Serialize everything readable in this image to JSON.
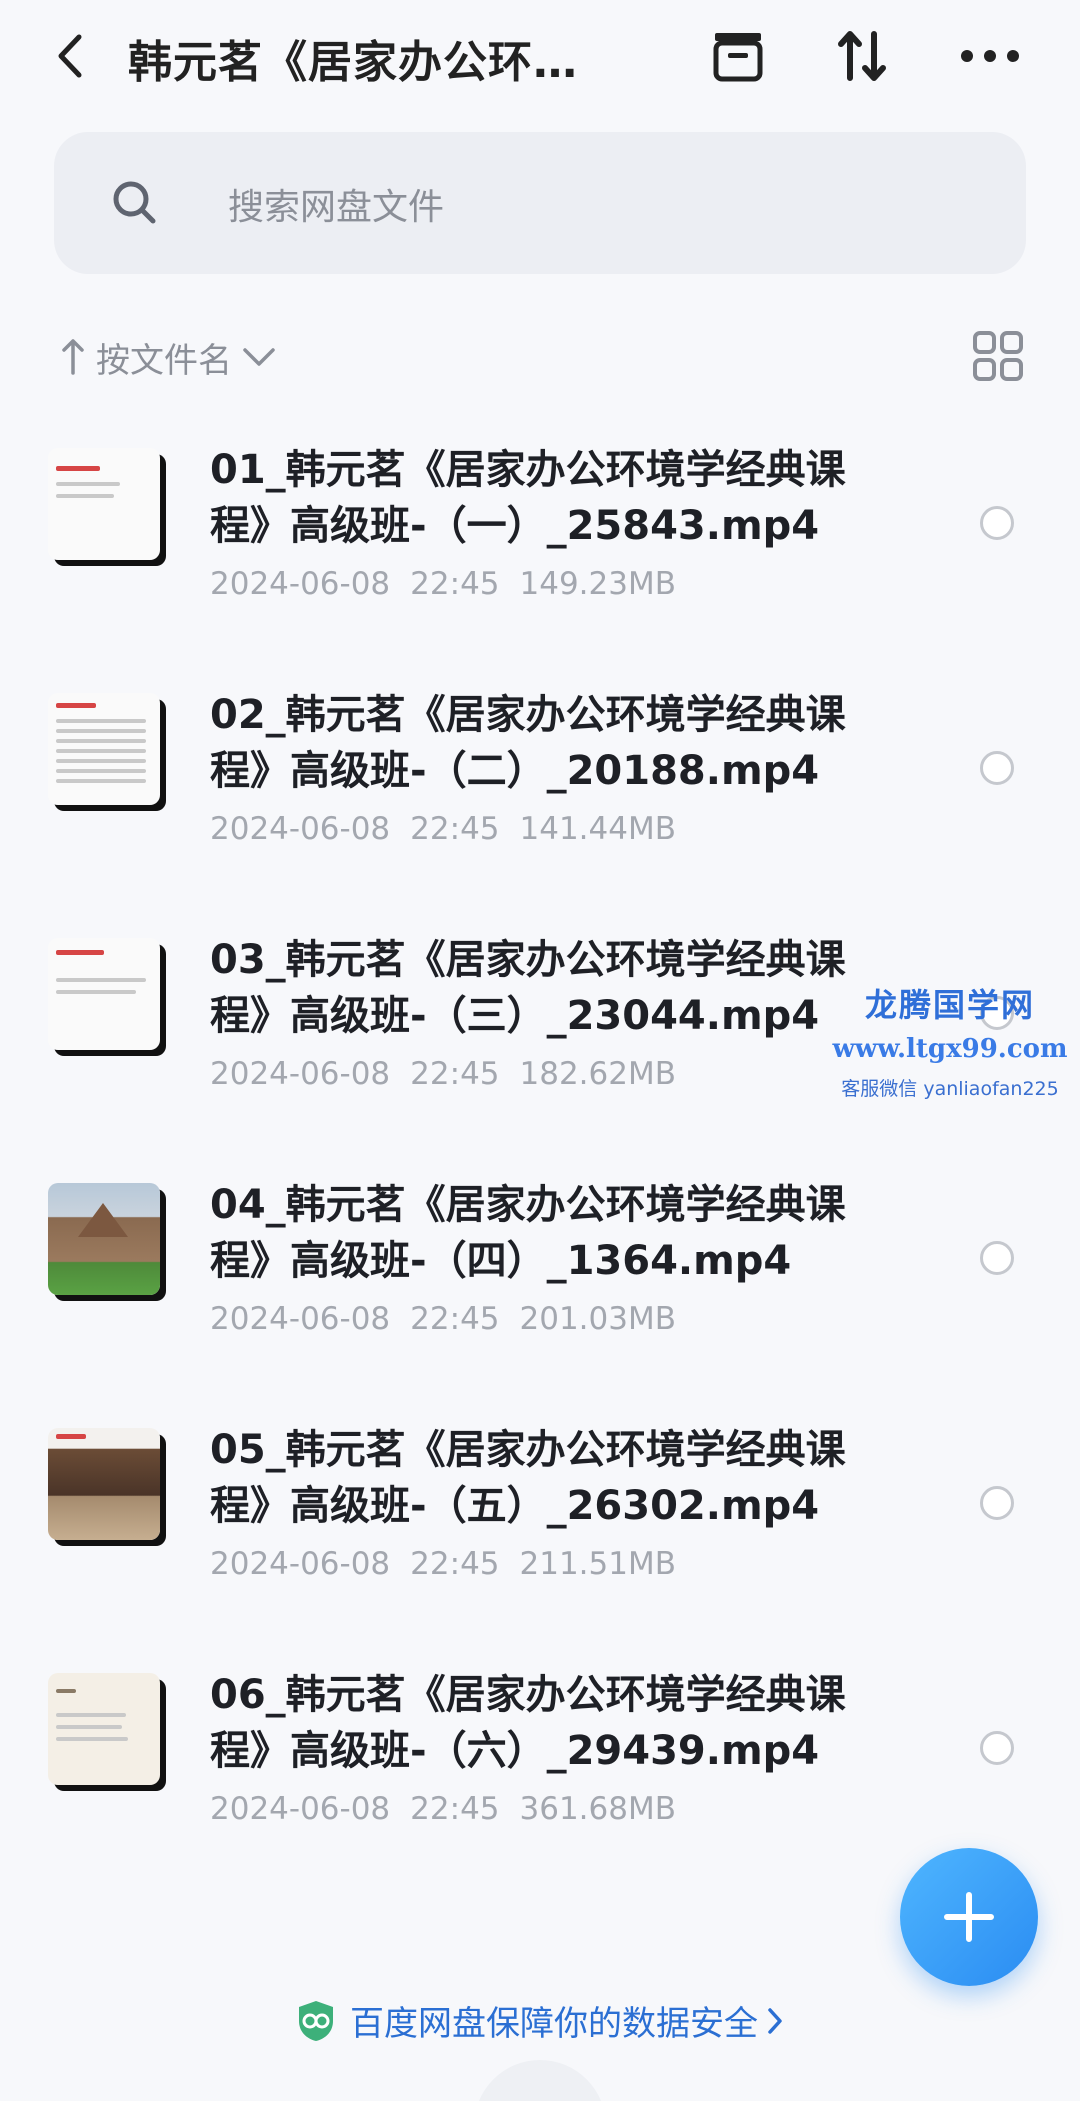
{
  "header": {
    "title": "韩元茗《居家办公环…",
    "icons": [
      "back-icon",
      "archive-icon",
      "sort-icon",
      "more-icon"
    ]
  },
  "search": {
    "placeholder": "搜索网盘文件"
  },
  "sort": {
    "label": "按文件名"
  },
  "files": [
    {
      "name": "01_韩元茗《居家办公环境学经典课程》高级班-（一）_25843.mp4",
      "date": "2024-06-08",
      "time": "22:45",
      "size": "149.23MB"
    },
    {
      "name": "02_韩元茗《居家办公环境学经典课程》高级班-（二）_20188.mp4",
      "date": "2024-06-08",
      "time": "22:45",
      "size": "141.44MB"
    },
    {
      "name": "03_韩元茗《居家办公环境学经典课程》高级班-（三）_23044.mp4",
      "date": "2024-06-08",
      "time": "22:45",
      "size": "182.62MB"
    },
    {
      "name": "04_韩元茗《居家办公环境学经典课程》高级班-（四）_1364.mp4",
      "date": "2024-06-08",
      "time": "22:45",
      "size": "201.03MB"
    },
    {
      "name": "05_韩元茗《居家办公环境学经典课程》高级班-（五）_26302.mp4",
      "date": "2024-06-08",
      "time": "22:45",
      "size": "211.51MB"
    },
    {
      "name": "06_韩元茗《居家办公环境学经典课程》高级班-（六）_29439.mp4",
      "date": "2024-06-08",
      "time": "22:45",
      "size": "361.68MB"
    }
  ],
  "watermark": {
    "name": "龙腾国学网",
    "url": "www.ltgx99.com",
    "contact": "客服微信 yanliaofan225"
  },
  "footer": {
    "security_text": "百度网盘保障你的数据安全"
  },
  "colors": {
    "accent": "#2a8cf2",
    "link": "#2b6fd3",
    "meta": "#a3a7af"
  }
}
